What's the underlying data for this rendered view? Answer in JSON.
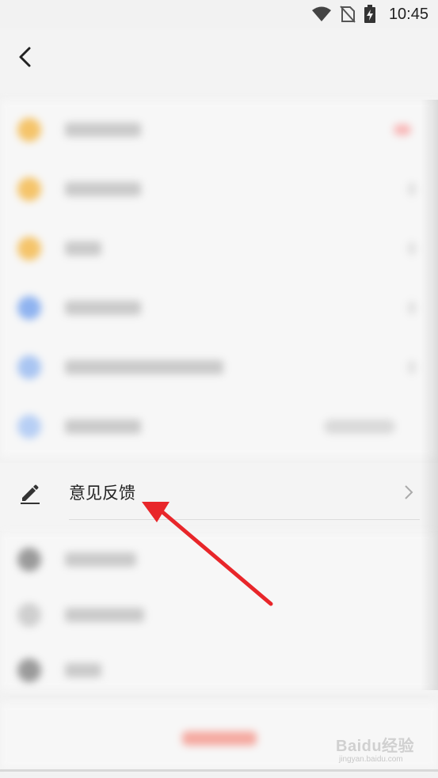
{
  "status_bar": {
    "time": "10:45",
    "icons": [
      "wifi-icon",
      "no-sim-icon",
      "battery-charging-icon"
    ]
  },
  "toolbar": {
    "back_icon": "back-arrow-icon"
  },
  "feedback_item": {
    "icon": "pencil-icon",
    "label": "意见反馈",
    "chevron": "chevron-right-icon"
  },
  "watermark": {
    "text": "Baidu经验",
    "url": "jingyan.baidu.com"
  },
  "colors": {
    "annotation_arrow": "#e8262a",
    "row_background": "#f4f4f4",
    "page_background": "#f2f2f2"
  }
}
